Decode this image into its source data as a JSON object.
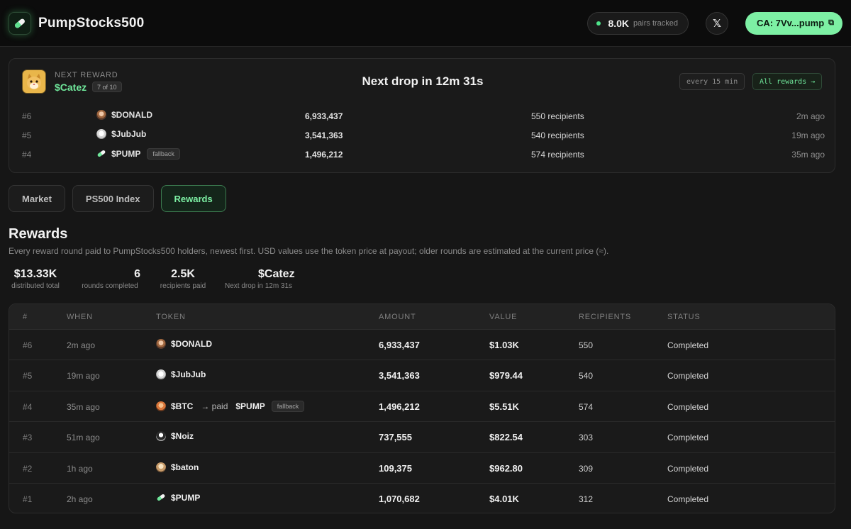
{
  "header": {
    "brand": "PumpStocks500",
    "tracked_value": "8.0K",
    "tracked_label": "pairs tracked",
    "x_label": "𝕏",
    "ca_label": "CA: 7Vv...pump",
    "copy_glyph": "⧉"
  },
  "next_reward": {
    "label": "NEXT REWARD",
    "token": "$Catez",
    "position": "7 of 10",
    "drop_text": "Next drop in 12m 31s",
    "interval": "every 15 min",
    "all_rewards": "All rewards →"
  },
  "recent": [
    {
      "num": "#6",
      "token": "$DONALD",
      "icon": "donald-token-icon",
      "amount": "6,933,437",
      "recipients": "550 recipients",
      "time": "2m ago",
      "tag": ""
    },
    {
      "num": "#5",
      "token": "$JubJub",
      "icon": "jubjub-token-icon",
      "amount": "3,541,363",
      "recipients": "540 recipients",
      "time": "19m ago",
      "tag": ""
    },
    {
      "num": "#4",
      "token": "$PUMP",
      "icon": "pump-pill-icon",
      "amount": "1,496,212",
      "recipients": "574 recipients",
      "time": "35m ago",
      "tag": "fallback"
    }
  ],
  "tabs": [
    "Market",
    "PS500 Index",
    "Rewards"
  ],
  "active_tab": "Rewards",
  "rewards": {
    "title": "Rewards",
    "subtitle": "Every reward round paid to PumpStocks500 holders, newest first. USD values use the token price at payout; older rounds are estimated at the current price (≈).",
    "stats": [
      {
        "value": "$13.33K",
        "label": "distributed total"
      },
      {
        "value": "6",
        "label": "rounds completed"
      },
      {
        "value": "2.5K",
        "label": "recipients paid"
      },
      {
        "value": "$Catez",
        "label": "Next drop in 12m 31s"
      }
    ],
    "columns": [
      "#",
      "WHEN",
      "TOKEN",
      "AMOUNT",
      "VALUE",
      "RECIPIENTS",
      "STATUS"
    ],
    "rows": [
      {
        "num": "#6",
        "when": "2m ago",
        "token": "$DONALD",
        "icon": "donald-token-icon",
        "paid_text": "",
        "paid_token": "",
        "tag": "",
        "amount": "6,933,437",
        "value": "$1.03K",
        "recipients": "550",
        "status": "Completed"
      },
      {
        "num": "#5",
        "when": "19m ago",
        "token": "$JubJub",
        "icon": "jubjub-token-icon",
        "paid_text": "",
        "paid_token": "",
        "tag": "",
        "amount": "3,541,363",
        "value": "$979.44",
        "recipients": "540",
        "status": "Completed"
      },
      {
        "num": "#4",
        "when": "35m ago",
        "token": "$BTC",
        "icon": "btc-token-icon",
        "paid_text": "→ paid",
        "paid_token": "$PUMP",
        "tag": "fallback",
        "amount": "1,496,212",
        "value": "$5.51K",
        "recipients": "574",
        "status": "Completed"
      },
      {
        "num": "#3",
        "when": "51m ago",
        "token": "$Noiz",
        "icon": "noiz-token-icon",
        "paid_text": "",
        "paid_token": "",
        "tag": "",
        "amount": "737,555",
        "value": "$822.54",
        "recipients": "303",
        "status": "Completed"
      },
      {
        "num": "#2",
        "when": "1h ago",
        "token": "$baton",
        "icon": "baton-token-icon",
        "paid_text": "",
        "paid_token": "",
        "tag": "",
        "amount": "109,375",
        "value": "$962.80",
        "recipients": "309",
        "status": "Completed"
      },
      {
        "num": "#1",
        "when": "2h ago",
        "token": "$PUMP",
        "icon": "pump-pill-icon",
        "paid_text": "",
        "paid_token": "",
        "tag": "",
        "amount": "1,070,682",
        "value": "$4.01K",
        "recipients": "312",
        "status": "Completed"
      }
    ]
  },
  "colors": {
    "accent": "#7df0a4",
    "background": "#161616",
    "topbar": "#0c0c0c"
  }
}
